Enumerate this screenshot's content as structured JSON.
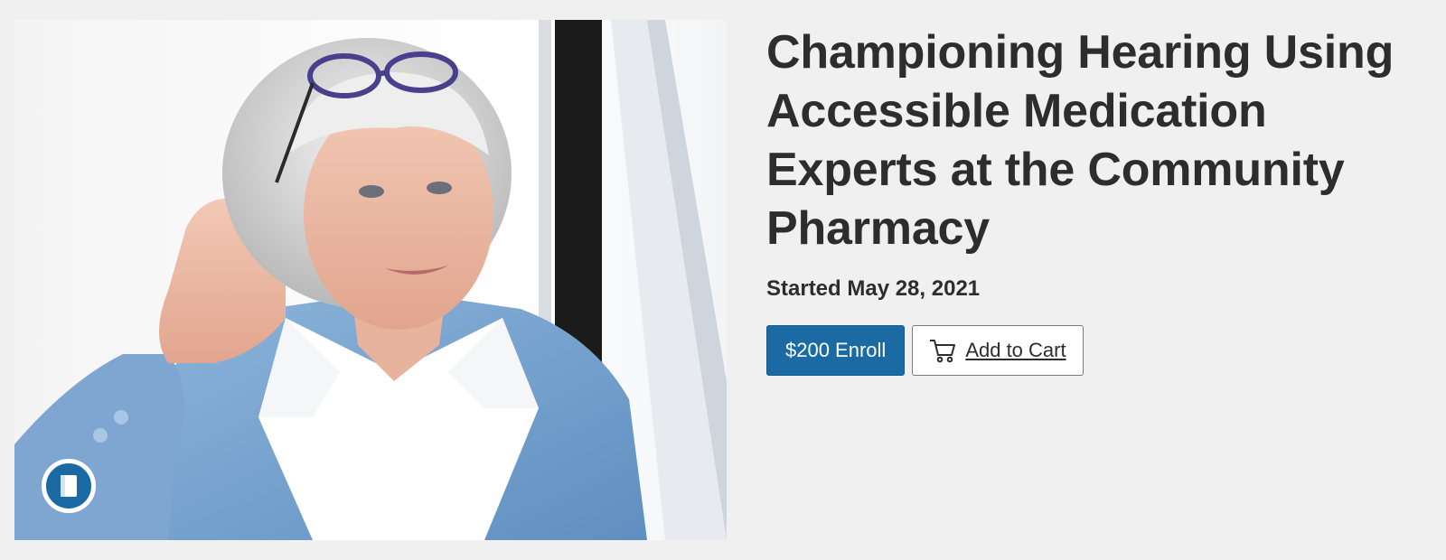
{
  "course": {
    "title": "Championing Hearing Using Accessible Medication Experts at the Community Pharmacy",
    "started": "Started May 28, 2021",
    "image_alt": "Older woman with glasses on her head cupping hand to her ear",
    "badge_icon": "book-icon"
  },
  "actions": {
    "enroll_label": "$200 Enroll",
    "cart_label": "Add to Cart",
    "cart_icon": "cart-icon"
  },
  "colors": {
    "primary": "#1c6aa3",
    "text": "#2d2d2d",
    "background": "#f0f0f0"
  }
}
